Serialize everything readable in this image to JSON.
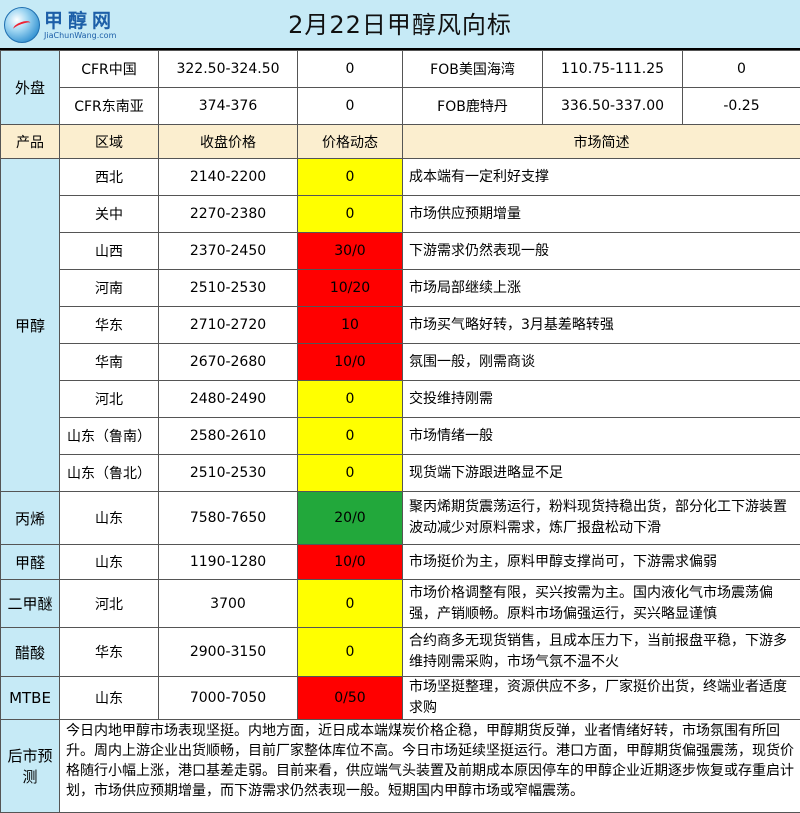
{
  "header": {
    "title": "2月22日甲醇风向标",
    "logo_cn": "甲醇网",
    "logo_en": "JiaChunWang.com"
  },
  "overseas": {
    "label": "外盘",
    "rows": [
      {
        "a_name": "CFR中国",
        "a_price": "322.50-324.50",
        "a_change": "0",
        "b_name": "FOB美国海湾",
        "b_price": "110.75-111.25",
        "b_change": "0"
      },
      {
        "a_name": "CFR东南亚",
        "a_price": "374-376",
        "a_change": "0",
        "b_name": "FOB鹿特丹",
        "b_price": "336.50-337.00",
        "b_change": "-0.25"
      }
    ]
  },
  "columns": [
    "产品",
    "区域",
    "收盘价格",
    "价格动态",
    "市场简述"
  ],
  "products": [
    {
      "name": "甲醇",
      "rows": [
        {
          "region": "西北",
          "price": "2140-2200",
          "change": "0",
          "status": "yellow",
          "note": "成本端有一定利好支撑"
        },
        {
          "region": "关中",
          "price": "2270-2380",
          "change": "0",
          "status": "yellow",
          "note": "市场供应预期增量"
        },
        {
          "region": "山西",
          "price": "2370-2450",
          "change": "30/0",
          "status": "red",
          "note": "下游需求仍然表现一般"
        },
        {
          "region": "河南",
          "price": "2510-2530",
          "change": "10/20",
          "status": "red",
          "note": "市场局部继续上涨"
        },
        {
          "region": "华东",
          "price": "2710-2720",
          "change": "10",
          "status": "red",
          "note": "市场买气略好转，3月基差略转强"
        },
        {
          "region": "华南",
          "price": "2670-2680",
          "change": "10/0",
          "status": "red",
          "note": "氛围一般，刚需商谈"
        },
        {
          "region": "河北",
          "price": "2480-2490",
          "change": "0",
          "status": "yellow",
          "note": "交投维持刚需"
        },
        {
          "region": "山东（鲁南）",
          "price": "2580-2610",
          "change": "0",
          "status": "yellow",
          "note": "市场情绪一般"
        },
        {
          "region": "山东（鲁北）",
          "price": "2510-2530",
          "change": "0",
          "status": "yellow",
          "note": "现货端下游跟进略显不足"
        }
      ]
    },
    {
      "name": "丙烯",
      "rows": [
        {
          "region": "山东",
          "price": "7580-7650",
          "change": "20/0",
          "status": "green",
          "note": "聚丙烯期货震荡运行，粉料现货持稳出货，部分化工下游装置波动减少对原料需求，炼厂报盘松动下滑"
        }
      ]
    },
    {
      "name": "甲醛",
      "rows": [
        {
          "region": "山东",
          "price": "1190-1280",
          "change": "10/0",
          "status": "red",
          "note": "市场挺价为主，原料甲醇支撑尚可，下游需求偏弱"
        }
      ]
    },
    {
      "name": "二甲醚",
      "rows": [
        {
          "region": "河北",
          "price": "3700",
          "change": "0",
          "status": "yellow",
          "note": "市场价格调整有限，买兴按需为主。国内液化气市场震荡偏强，产销顺畅。原料市场偏强运行，买兴略显谨慎"
        }
      ]
    },
    {
      "name": "醋酸",
      "rows": [
        {
          "region": "华东",
          "price": "2900-3150",
          "change": "0",
          "status": "yellow",
          "note": "合约商多无现货销售，且成本压力下，当前报盘平稳，下游多维持刚需采购，市场气氛不温不火"
        }
      ]
    },
    {
      "name": "MTBE",
      "rows": [
        {
          "region": "山东",
          "price": "7000-7050",
          "change": "0/50",
          "status": "red",
          "note": "市场坚挺整理，资源供应不多，厂家挺价出货，终端业者适度求购"
        }
      ]
    }
  ],
  "forecast": {
    "label": "后市预测",
    "text": "今日内地甲醇市场表现坚挺。内地方面，近日成本端煤炭价格企稳，甲醇期货反弹，业者情绪好转，市场氛围有所回升。周内上游企业出货顺畅，目前厂家整体库位不高。今日市场延续坚挺运行。港口方面，甲醇期货偏强震荡，现货价格随行小幅上涨，港口基差走弱。目前来看，供应端气头装置及前期成本原因停车的甲醇企业近期逐步恢复或存重启计划，市场供应预期增量，而下游需求仍然表现一般。短期国内甲醇市场或窄幅震荡。"
  },
  "colors": {
    "yellow": "#ffff00",
    "red": "#ff0000",
    "green": "#22a83b",
    "blue_bg": "#c6eaf6",
    "header_bg": "#fbeecf"
  }
}
